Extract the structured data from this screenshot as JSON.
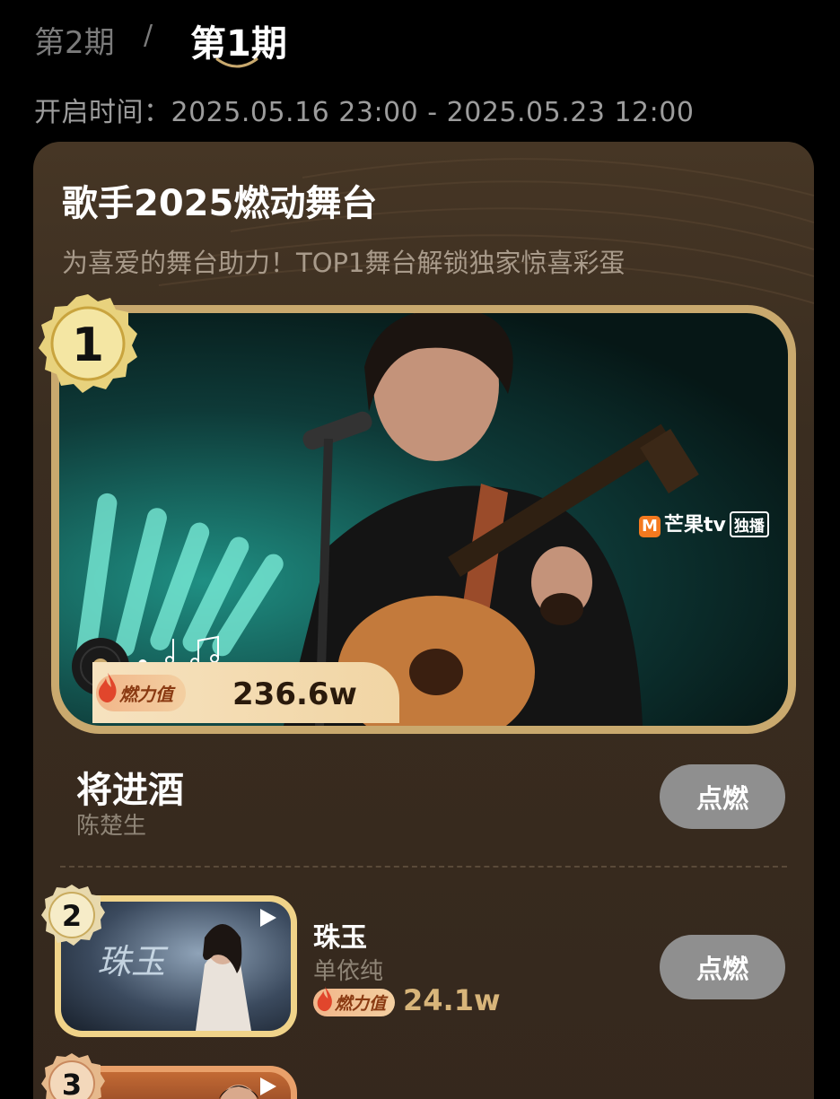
{
  "header": {
    "tab_prev": "第2期",
    "separator": "/",
    "tab_active": "第1期",
    "time_range": "开启时间：2025.05.16 23:00 - 2025.05.23 12:00"
  },
  "card": {
    "title": "歌手2025燃动舞台",
    "subtitle": "为喜爱的舞台助力！TOP1舞台解锁独家惊喜彩蛋"
  },
  "brand": {
    "name": "芒果tv",
    "tag": "独播",
    "color": "#f4791f"
  },
  "fire_label": "燃力值",
  "button_label": "点燃",
  "songs": [
    {
      "rank": "1",
      "title": "将进酒",
      "artist": "陈楚生",
      "fire_value": "236.6w"
    },
    {
      "rank": "2",
      "title": "珠玉",
      "artist": "单依纯",
      "fire_value": "24.1w",
      "thumb_text": "珠玉"
    },
    {
      "rank": "3",
      "title": "",
      "artist": "",
      "fire_value": ""
    }
  ],
  "colors": {
    "gold": "#c9a96e",
    "button": "#8f8f8f",
    "card_bg": "#3a2d20"
  }
}
